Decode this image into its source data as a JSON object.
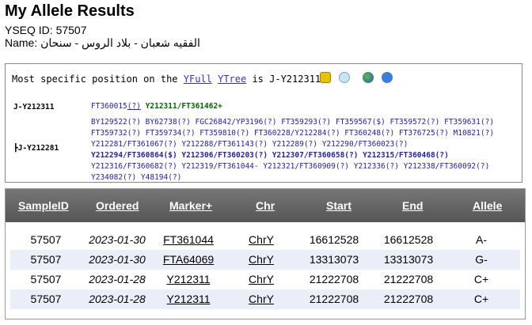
{
  "title": "My Allele Results",
  "yseq_label": "YSEQ ID: 57507",
  "name_label": "Name: الفقيه شعبان - بلاد الروس - سنحان",
  "ytree": {
    "prefix": "Most specific position on the ",
    "yfull": "YFull",
    "ytree_link": "YTree",
    "is": " is J-Y212311",
    "nodes": [
      "J-Y212311",
      "┣J-Y212281"
    ],
    "snp_line1_a": "FT360015",
    "snp_line1_q": "(?)",
    "snp_line1_b": "Y212311/FT361462+",
    "rows": [
      "BY129522(?) BY62738(?) FGC26842/YP3196(?) FT359293(?) FT359567($) FT359572(?) FT359631(?)",
      "FT359732(?) FT359734(?) FT359810(?) FT360228/Y212284(?) FT360248(?) FT376725(?) M10821(?)",
      "Y212281/FT361067(?) Y212288/FT361143(?) Y212289(?) Y212290/FT360023(?)",
      "Y212294/FT360864($) Y212306/FT360203(?) Y212307/FT360658(?) Y212315/FT360468(?)",
      "Y212316/FT360682(?) Y212319/FT361044- Y212321/FT360909(?) Y212336(?) Y212338/FT360092(?)",
      "Y234082(?) Y48194(?)"
    ]
  },
  "table": {
    "headers": [
      "SampleID",
      "Ordered",
      "Marker+",
      "Chr",
      "Start",
      "End",
      "Allele"
    ],
    "rows": [
      [
        "57507",
        "2023-01-30",
        "FT361044",
        "ChrY",
        "16612528",
        "16612528",
        "A-"
      ],
      [
        "57507",
        "2023-01-30",
        "FTA64069",
        "ChrY",
        "13313073",
        "13313073",
        "G-"
      ],
      [
        "57507",
        "2023-01-28",
        "Y212311",
        "ChrY",
        "21222708",
        "21222708",
        "C+"
      ],
      [
        "57507",
        "2023-01-28",
        "Y212311",
        "ChrY",
        "21222708",
        "21222708",
        "C+"
      ]
    ]
  },
  "colors": {
    "header_bg": "#666666",
    "alt_row": "#e9eef8",
    "link": "#3333cc",
    "derived": "#006600",
    "negative": "#dd0000"
  },
  "icons": [
    "yfull-icon",
    "ytree-icon",
    "globe-icon",
    "help-icon"
  ]
}
